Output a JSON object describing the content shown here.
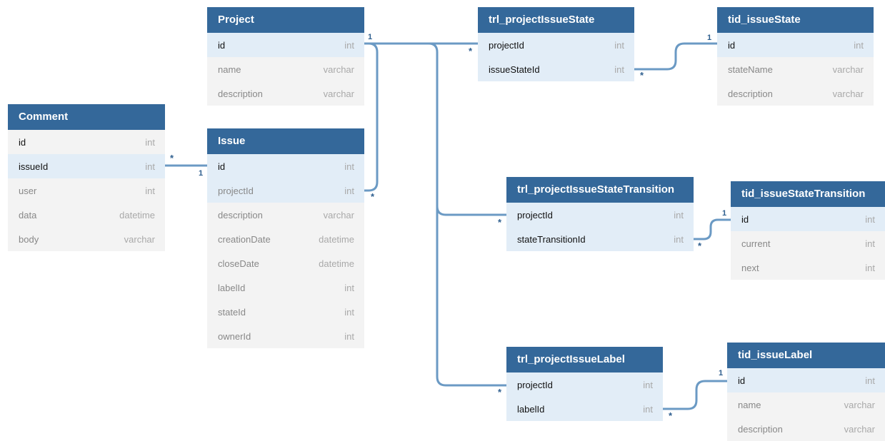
{
  "tables": [
    {
      "name": "Project",
      "columns": [
        {
          "name": "id",
          "type": "int",
          "highlight": true
        },
        {
          "name": "name",
          "type": "varchar",
          "highlight": false
        },
        {
          "name": "description",
          "type": "varchar",
          "highlight": false
        }
      ]
    },
    {
      "name": "Comment",
      "columns": [
        {
          "name": "id",
          "type": "int",
          "highlight": false
        },
        {
          "name": "issueId",
          "type": "int",
          "highlight": true
        },
        {
          "name": "user",
          "type": "int",
          "highlight": false
        },
        {
          "name": "data",
          "type": "datetime",
          "highlight": false
        },
        {
          "name": "body",
          "type": "varchar",
          "highlight": false
        }
      ]
    },
    {
      "name": "Issue",
      "columns": [
        {
          "name": "id",
          "type": "int",
          "highlight": true
        },
        {
          "name": "projectId",
          "type": "int",
          "highlight": true
        },
        {
          "name": "description",
          "type": "varchar",
          "highlight": false
        },
        {
          "name": "creationDate",
          "type": "datetime",
          "highlight": false
        },
        {
          "name": "closeDate",
          "type": "datetime",
          "highlight": false
        },
        {
          "name": "labelId",
          "type": "int",
          "highlight": false
        },
        {
          "name": "stateId",
          "type": "int",
          "highlight": false
        },
        {
          "name": "ownerId",
          "type": "int",
          "highlight": false
        }
      ]
    },
    {
      "name": "trl_projectIssueState",
      "columns": [
        {
          "name": "projectId",
          "type": "int",
          "highlight": true
        },
        {
          "name": "issueStateId",
          "type": "int",
          "highlight": true
        }
      ]
    },
    {
      "name": "tid_issueState",
      "columns": [
        {
          "name": "id",
          "type": "int",
          "highlight": true
        },
        {
          "name": "stateName",
          "type": "varchar",
          "highlight": false
        },
        {
          "name": "description",
          "type": "varchar",
          "highlight": false
        }
      ]
    },
    {
      "name": "trl_projectIssueStateTransition",
      "columns": [
        {
          "name": "projectId",
          "type": "int",
          "highlight": true
        },
        {
          "name": "stateTransitionId",
          "type": "int",
          "highlight": true
        }
      ]
    },
    {
      "name": "tid_issueStateTransition",
      "columns": [
        {
          "name": "id",
          "type": "int",
          "highlight": true
        },
        {
          "name": "current",
          "type": "int",
          "highlight": false
        },
        {
          "name": "next",
          "type": "int",
          "highlight": false
        }
      ]
    },
    {
      "name": "trl_projectIssueLabel",
      "columns": [
        {
          "name": "projectId",
          "type": "int",
          "highlight": true
        },
        {
          "name": "labelId",
          "type": "int",
          "highlight": true
        }
      ]
    },
    {
      "name": "tid_issueLabel",
      "columns": [
        {
          "name": "id",
          "type": "int",
          "highlight": true
        },
        {
          "name": "name",
          "type": "varchar",
          "highlight": false
        },
        {
          "name": "description",
          "type": "varchar",
          "highlight": false
        }
      ]
    }
  ],
  "relations": [
    {
      "from_table": "Project",
      "from_column": "id",
      "from_card": "1",
      "to_table": "Issue",
      "to_column": "projectId",
      "to_card": "*"
    },
    {
      "from_table": "Project",
      "from_column": "id",
      "from_card": "1",
      "to_table": "trl_projectIssueState",
      "to_column": "projectId",
      "to_card": "*"
    },
    {
      "from_table": "Project",
      "from_column": "id",
      "from_card": "1",
      "to_table": "trl_projectIssueStateTransition",
      "to_column": "projectId",
      "to_card": "*"
    },
    {
      "from_table": "Project",
      "from_column": "id",
      "from_card": "1",
      "to_table": "trl_projectIssueLabel",
      "to_column": "projectId",
      "to_card": "*"
    },
    {
      "from_table": "Issue",
      "from_column": "id",
      "from_card": "1",
      "to_table": "Comment",
      "to_column": "issueId",
      "to_card": "*"
    },
    {
      "from_table": "tid_issueState",
      "from_column": "id",
      "from_card": "1",
      "to_table": "trl_projectIssueState",
      "to_column": "issueStateId",
      "to_card": "*"
    },
    {
      "from_table": "tid_issueStateTransition",
      "from_column": "id",
      "from_card": "1",
      "to_table": "trl_projectIssueStateTransition",
      "to_column": "stateTransitionId",
      "to_card": "*"
    },
    {
      "from_table": "tid_issueLabel",
      "from_column": "id",
      "from_card": "1",
      "to_table": "trl_projectIssueLabel",
      "to_column": "labelId",
      "to_card": "*"
    }
  ],
  "colors": {
    "header": "#34689a",
    "body": "#f3f3f3",
    "key_row": "#e2edf7",
    "link": "#6b9ac4"
  }
}
